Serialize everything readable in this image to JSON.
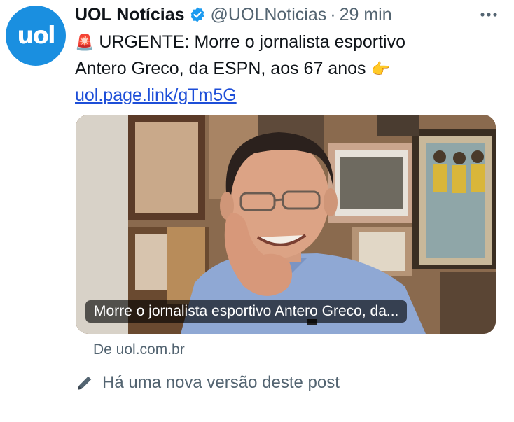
{
  "account": {
    "avatar_text": "uol",
    "name": "UOL Notícias",
    "handle": "@UOLNoticias",
    "separator": "·",
    "time": "29 min",
    "brand_color": "#1a8fe0",
    "verified_icon": "verified-badge-icon"
  },
  "post": {
    "alert_emoji": "🚨",
    "text_line1": "URGENTE: Morre o jornalista esportivo",
    "text_line2": "Antero Greco, da ESPN, aos 67 anos",
    "pointing_emoji": "👉",
    "link": "uol.page.link/gTm5G"
  },
  "card": {
    "caption": "Morre o jornalista esportivo Antero Greco, da...",
    "source": "De uol.com.br",
    "image_description_icon": "news-photo"
  },
  "footer": {
    "new_version_text": "Há uma nova versão deste post",
    "icon": "pencil-icon"
  },
  "menu": {
    "icon": "more-options-icon"
  }
}
